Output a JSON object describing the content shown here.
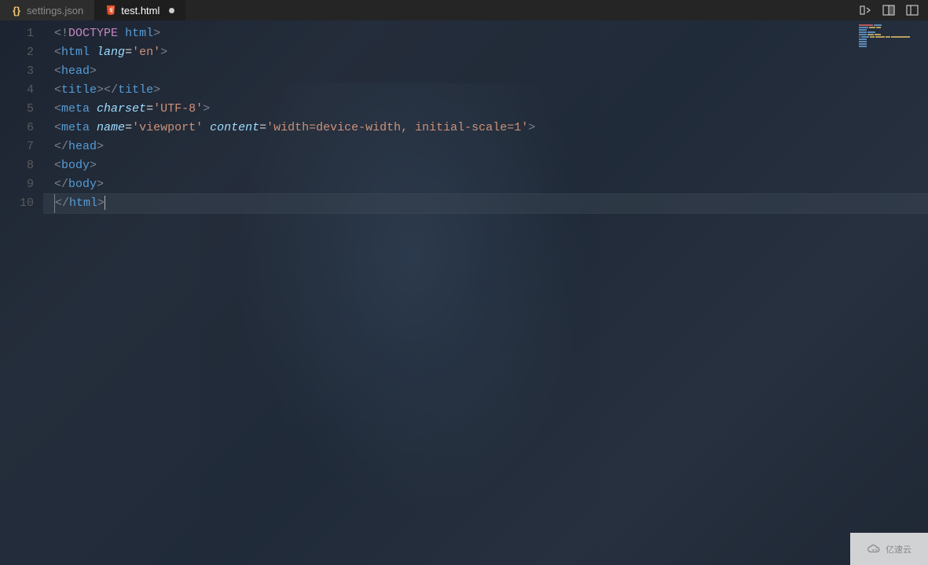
{
  "tabs": [
    {
      "icon": "json",
      "label": "settings.json",
      "active": false,
      "modified": false
    },
    {
      "icon": "html",
      "label": "test.html",
      "active": true,
      "modified": true
    }
  ],
  "actions": [
    "compare-icon",
    "split-icon",
    "layout-icon"
  ],
  "gutter": [
    "1",
    "2",
    "3",
    "4",
    "5",
    "6",
    "7",
    "8",
    "9",
    "10"
  ],
  "code": {
    "lines": [
      {
        "indent": 0,
        "tokens": [
          {
            "t": "<",
            "c": "bracket"
          },
          {
            "t": "!",
            "c": "bracket"
          },
          {
            "t": "DOCTYPE",
            "c": "doctype"
          },
          {
            "t": " ",
            "c": ""
          },
          {
            "t": "html",
            "c": "tag"
          },
          {
            "t": ">",
            "c": "bracket"
          }
        ]
      },
      {
        "indent": 0,
        "tokens": [
          {
            "t": "<",
            "c": "bracket"
          },
          {
            "t": "html",
            "c": "tag"
          },
          {
            "t": " ",
            "c": ""
          },
          {
            "t": "lang",
            "c": "attr-name"
          },
          {
            "t": "=",
            "c": "eq"
          },
          {
            "t": "'en'",
            "c": "attr-val"
          },
          {
            "t": ">",
            "c": "bracket"
          }
        ]
      },
      {
        "indent": 0,
        "tokens": [
          {
            "t": "<",
            "c": "bracket"
          },
          {
            "t": "head",
            "c": "tag"
          },
          {
            "t": ">",
            "c": "bracket"
          }
        ]
      },
      {
        "indent": 0,
        "tokens": [
          {
            "t": "<",
            "c": "bracket"
          },
          {
            "t": "title",
            "c": "tag"
          },
          {
            "t": ">",
            "c": "bracket"
          },
          {
            "t": "<",
            "c": "bracket"
          },
          {
            "t": "/",
            "c": "bracket"
          },
          {
            "t": "title",
            "c": "tag"
          },
          {
            "t": ">",
            "c": "bracket"
          }
        ]
      },
      {
        "indent": 0,
        "tokens": [
          {
            "t": "<",
            "c": "bracket"
          },
          {
            "t": "meta",
            "c": "tag"
          },
          {
            "t": " ",
            "c": ""
          },
          {
            "t": "charset",
            "c": "attr-name"
          },
          {
            "t": "=",
            "c": "eq"
          },
          {
            "t": "'UTF-8'",
            "c": "attr-val"
          },
          {
            "t": ">",
            "c": "bracket"
          }
        ]
      },
      {
        "indent": 1,
        "tokens": [
          {
            "t": "<",
            "c": "bracket"
          },
          {
            "t": "meta",
            "c": "tag"
          },
          {
            "t": " ",
            "c": ""
          },
          {
            "t": "name",
            "c": "attr-name"
          },
          {
            "t": "=",
            "c": "eq"
          },
          {
            "t": "'viewport'",
            "c": "attr-val"
          },
          {
            "t": " ",
            "c": ""
          },
          {
            "t": "content",
            "c": "attr-name"
          },
          {
            "t": "=",
            "c": "eq"
          },
          {
            "t": "'width=device-width, initial-scale=1'",
            "c": "attr-val"
          },
          {
            "t": ">",
            "c": "bracket"
          }
        ]
      },
      {
        "indent": 0,
        "tokens": [
          {
            "t": "<",
            "c": "bracket"
          },
          {
            "t": "/",
            "c": "bracket"
          },
          {
            "t": "head",
            "c": "tag"
          },
          {
            "t": ">",
            "c": "bracket"
          }
        ]
      },
      {
        "indent": 0,
        "tokens": [
          {
            "t": "<",
            "c": "bracket"
          },
          {
            "t": "body",
            "c": "tag"
          },
          {
            "t": ">",
            "c": "bracket"
          }
        ]
      },
      {
        "indent": 0,
        "tokens": [
          {
            "t": "<",
            "c": "bracket"
          },
          {
            "t": "/",
            "c": "bracket"
          },
          {
            "t": "body",
            "c": "tag"
          },
          {
            "t": ">",
            "c": "bracket"
          }
        ]
      },
      {
        "indent": 0,
        "current": true,
        "tokens": [
          {
            "t": "<",
            "c": "bracket box-left"
          },
          {
            "t": "/",
            "c": "bracket"
          },
          {
            "t": "html",
            "c": "tag"
          },
          {
            "t": ">",
            "c": "bracket"
          },
          {
            "t": "",
            "c": "cursor"
          }
        ]
      }
    ]
  },
  "watermark": {
    "text": "亿速云"
  }
}
